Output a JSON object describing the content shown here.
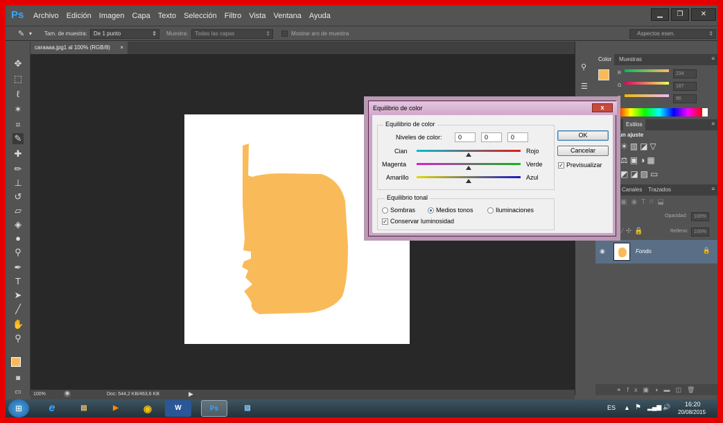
{
  "app": {
    "logo": "Ps"
  },
  "menu": [
    "Archivo",
    "Edición",
    "Imagen",
    "Capa",
    "Texto",
    "Selección",
    "Filtro",
    "Vista",
    "Ventana",
    "Ayuda"
  ],
  "window_controls": {
    "minimize": "▁",
    "restore": "❐",
    "close": "✕"
  },
  "options": {
    "size_label": "Tam. de muestra:",
    "size_value": "De 1 punto",
    "sample_label": "Muestra:",
    "sample_value": "Todas las capas",
    "ring_label": "Mostrar aro de muestra",
    "workspace": "Aspectos esen."
  },
  "document": {
    "tab": "caraaaa.jpg1 al 100% (RGB/8)",
    "close": "×",
    "fill_color": "#f9bb59"
  },
  "status": {
    "zoom": "100%",
    "doc_size": "Doc: 544,2 KB/463,6 KB"
  },
  "color_panel": {
    "tabs": [
      "Color",
      "Muestras"
    ],
    "r_label": "R",
    "g_label": "G",
    "b_label": "B",
    "r": "234",
    "g": "187",
    "b": "96"
  },
  "adjust_panel": {
    "tab": "Estilos",
    "title": "un ajuste"
  },
  "layers_panel": {
    "tabs": [
      "Canales",
      "Trazados"
    ],
    "opacity_label": "Opacidad:",
    "opacity": "100%",
    "fill_label": "Relleno:",
    "fill": "100%",
    "layer_name": "Fondo"
  },
  "dialog": {
    "title": "Equilibrio de color",
    "close": "x",
    "group1": "Equilibrio de color",
    "levels_label": "Niveles de color:",
    "levels": [
      "0",
      "0",
      "0"
    ],
    "cyan": "Cian",
    "red": "Rojo",
    "magenta": "Magenta",
    "green": "Verde",
    "yellow": "Amarillo",
    "blue": "Azul",
    "group2": "Equilibrio tonal",
    "shadows": "Sombras",
    "midtones": "Medios tonos",
    "highlights": "Iluminaciones",
    "preserve": "Conservar luminosidad",
    "ok": "OK",
    "cancel": "Cancelar",
    "preview": "Previsualizar"
  },
  "taskbar": {
    "lang": "ES",
    "time": "16:20",
    "date": "20/08/2015"
  }
}
